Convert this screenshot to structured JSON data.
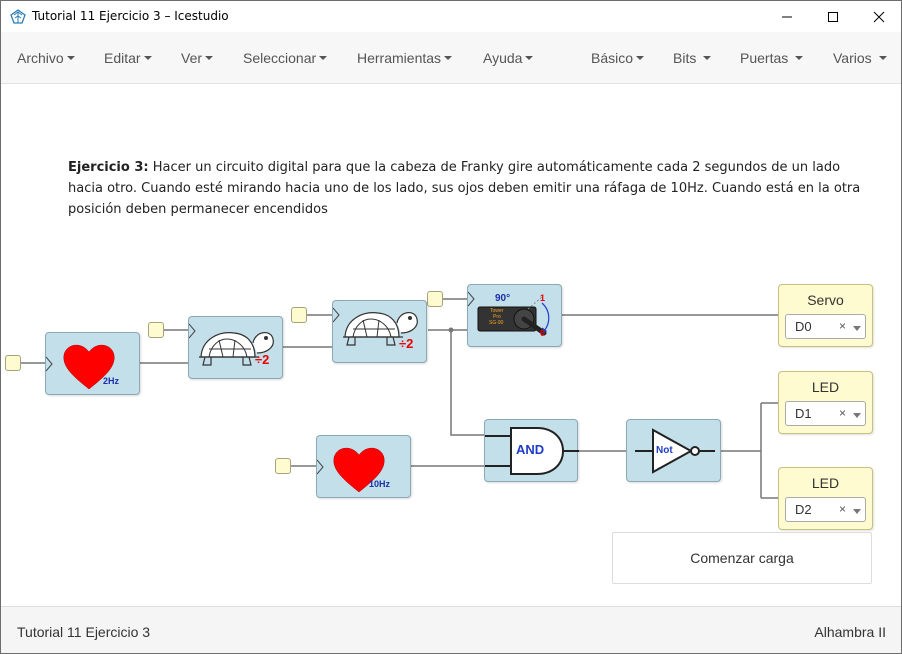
{
  "window": {
    "title": "Tutorial 11 Ejercicio 3 – Icestudio"
  },
  "menu": {
    "left": [
      {
        "label": "Archivo"
      },
      {
        "label": "Editar"
      },
      {
        "label": "Ver"
      },
      {
        "label": "Seleccionar"
      },
      {
        "label": "Herramientas"
      },
      {
        "label": "Ayuda"
      }
    ],
    "right": [
      {
        "label": "Básico"
      },
      {
        "label": "Bits"
      },
      {
        "label": "Puertas"
      },
      {
        "label": "Varios"
      }
    ]
  },
  "info": {
    "heading": "Ejercicio 3:",
    "body": " Hacer un circuito digital para que la cabeza de Franky gire automáticamente cada 2 segundos de un lado hacia otro. Cuando esté mirando hacia uno de los lado, sus ojos deben emitir una ráfaga de 10Hz. Cuando está en la otra posición deben permanecer encendidos"
  },
  "blocks": {
    "heart_2hz": {
      "label": "2Hz"
    },
    "heart_10hz": {
      "label": "10Hz"
    },
    "prescaler_1": {
      "label": "÷2"
    },
    "prescaler_2": {
      "label": "÷2"
    },
    "servo_block": {
      "angle": "90°",
      "mark_top": "1",
      "mark_bottom": "0",
      "body_text_1": "Tower",
      "body_text_2": "Pro",
      "body_text_3": "SG-90"
    },
    "and_gate": {
      "label": "AND"
    },
    "not_gate": {
      "label": "Not"
    }
  },
  "outputs": [
    {
      "title": "Servo",
      "value": "D0",
      "clear": "×"
    },
    {
      "title": "LED",
      "value": "D1",
      "clear": "×"
    },
    {
      "title": "LED",
      "value": "D2",
      "clear": "×"
    }
  ],
  "load_button": {
    "label": "Comenzar carga"
  },
  "footer": {
    "project": "Tutorial 11 Ejercicio 3",
    "board": "Alhambra II"
  },
  "colors": {
    "block_fill": "#c3dfea",
    "io_fill": "#fffbd0",
    "heart": "#ff0000",
    "menu_bg": "#f7f7f7"
  }
}
